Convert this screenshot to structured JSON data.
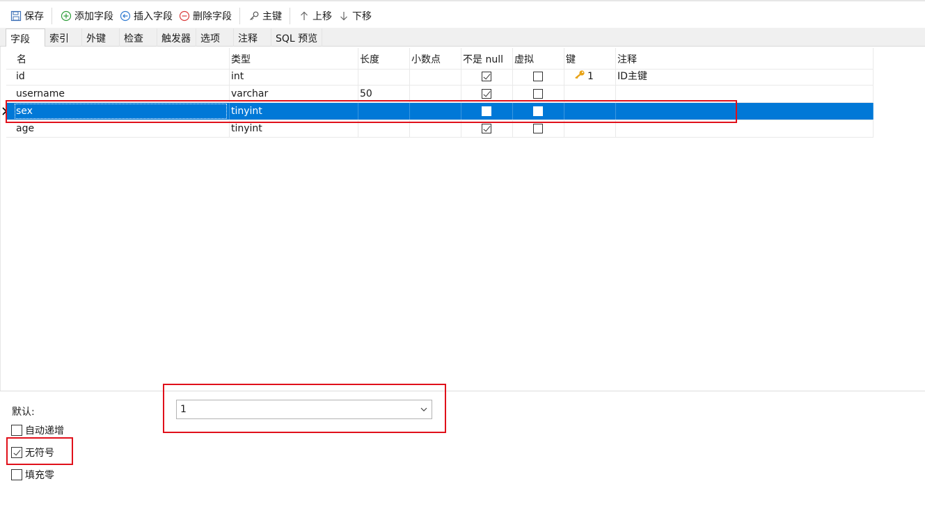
{
  "toolbar": {
    "save": "保存",
    "add_field": "添加字段",
    "insert_field": "插入字段",
    "delete_field": "删除字段",
    "primary_key": "主键",
    "move_up": "上移",
    "move_down": "下移"
  },
  "tabs": [
    "字段",
    "索引",
    "外键",
    "检查",
    "触发器",
    "选项",
    "注释",
    "SQL 预览"
  ],
  "active_tab": "字段",
  "columns": [
    "名",
    "类型",
    "长度",
    "小数点",
    "不是 null",
    "虚拟",
    "键",
    "注释"
  ],
  "rows": [
    {
      "name": "id",
      "type": "int",
      "length": "",
      "decimals": "",
      "not_null": true,
      "virtual": false,
      "key": "1",
      "comment": "ID主键"
    },
    {
      "name": "username",
      "type": "varchar",
      "length": "50",
      "decimals": "",
      "not_null": true,
      "virtual": false,
      "key": "",
      "comment": ""
    },
    {
      "name": "sex",
      "type": "tinyint",
      "length": "",
      "decimals": "",
      "not_null": false,
      "virtual": false,
      "key": "",
      "comment": ""
    },
    {
      "name": "age",
      "type": "tinyint",
      "length": "",
      "decimals": "",
      "not_null": true,
      "virtual": false,
      "key": "",
      "comment": ""
    }
  ],
  "selected_row": "sex",
  "properties": {
    "default_label": "默认:",
    "default_value": "1",
    "auto_increment_label": "自动递增",
    "auto_increment": false,
    "unsigned_label": "无符号",
    "unsigned": true,
    "zerofill_label": "填充零",
    "zerofill": false
  },
  "colors": {
    "selection": "#0078d7",
    "annotation": "#e0101a",
    "key_icon": "#e8a317"
  }
}
